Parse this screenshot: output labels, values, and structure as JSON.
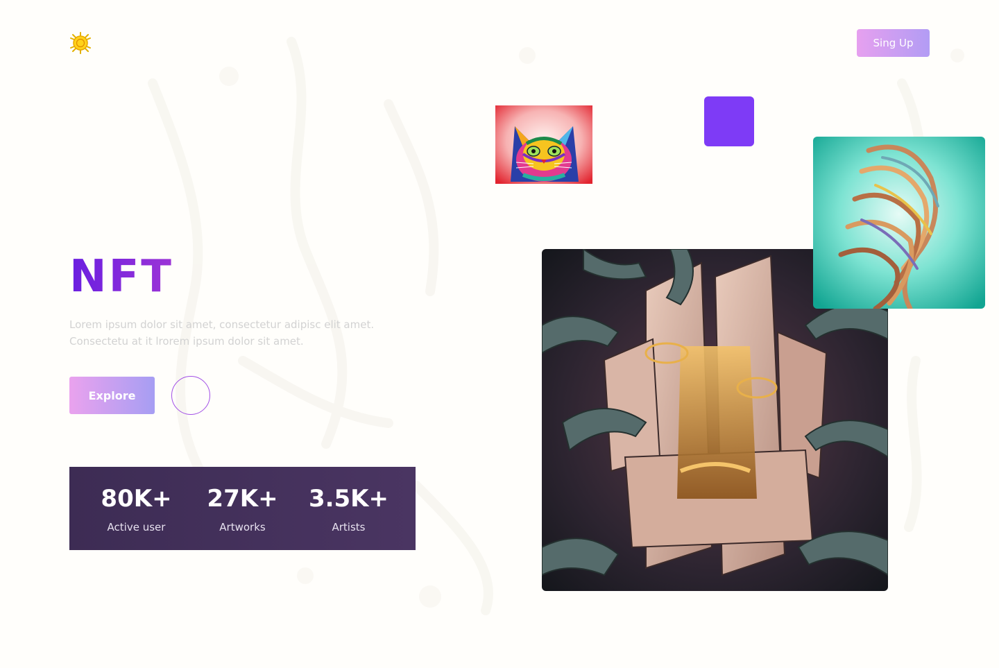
{
  "header": {
    "logo_icon": "sun-coin-logo-icon",
    "signup_label": "Sing Up"
  },
  "hero": {
    "title": "NFT",
    "description_lines": [
      "Lorem ipsum dolor sit amet, consectetur adipisc elit amet.",
      "Consectetu at it lrorem ipsum dolor sit amet."
    ],
    "explore_label": "Explore",
    "circle_button_icon": "circle-outline-icon"
  },
  "stats": [
    {
      "value": "80K+",
      "label": "Active user"
    },
    {
      "value": "27K+",
      "label": "Artworks"
    },
    {
      "value": "3.5K+",
      "label": "Artists"
    }
  ],
  "artworks": {
    "cat": "colorful-cat-artwork",
    "accent_square": "purple-square",
    "main": "fractured-mask-artwork",
    "side": "teal-abstract-portrait-artwork"
  },
  "colors": {
    "accent_purple": "#7e3bf6",
    "title_gradient_start": "#6a1fe0",
    "title_gradient_end": "#9c34d6",
    "button_gradient_start": "#eaa2ee",
    "button_gradient_end": "#a69ef3",
    "stats_background": "#3d2c54",
    "page_background": "#fffefb"
  }
}
